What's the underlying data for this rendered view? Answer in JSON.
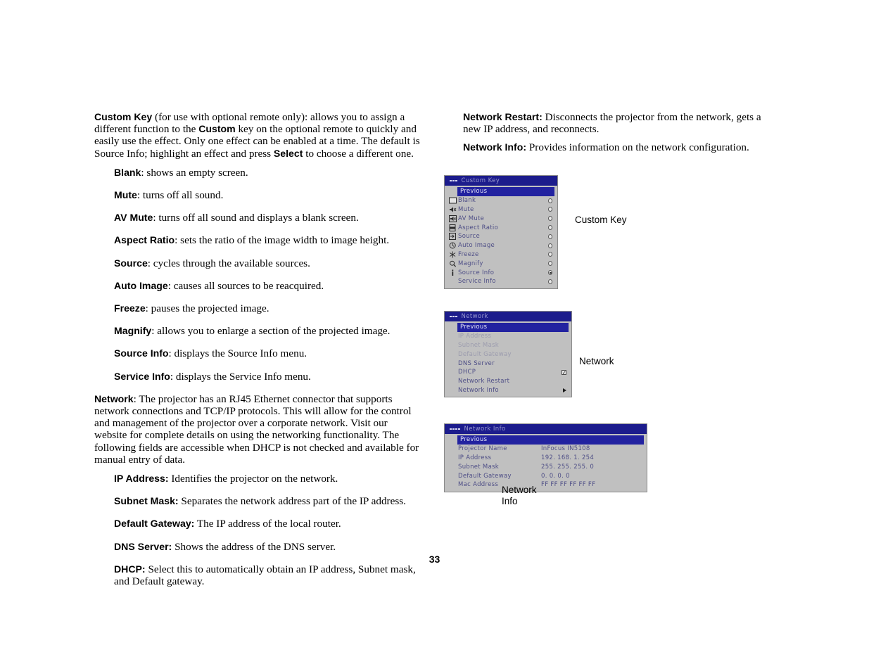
{
  "page": {
    "number": "33"
  },
  "left_column": {
    "intro": {
      "lead": "Custom Key",
      "text": " (for use with optional remote only): allows you to assign a different function to the ",
      "lead2": "Custom",
      "text2": " key on the optional remote to quickly and easily use the effect. Only one effect can be enabled at a time. The default is Source Info; highlight an effect and press ",
      "lead3": "Select",
      "text3": " to choose a different one."
    },
    "effects": [
      {
        "term": "Blank",
        "desc": ": shows an empty screen."
      },
      {
        "term": "Mute",
        "desc": ": turns off all sound."
      },
      {
        "term": "AV Mute",
        "desc": ": turns off all sound and displays a blank screen."
      },
      {
        "term": "Aspect Ratio",
        "desc": ": sets the ratio of the image width to image height."
      },
      {
        "term": "Source",
        "desc": ": cycles through the available sources."
      },
      {
        "term": "Auto Image",
        "desc": ": causes all sources to be reacquired."
      },
      {
        "term": "Freeze",
        "desc": ": pauses the projected image."
      },
      {
        "term": "Magnify",
        "desc": ": allows you to enlarge a section of the projected image."
      },
      {
        "term": "Source Info",
        "desc": ": displays the Source Info menu."
      },
      {
        "term": "Service Info",
        "desc": ": displays the Service Info menu."
      }
    ],
    "network_paragraph": {
      "term": "Network",
      "desc": ": The projector has an RJ45 Ethernet connector that supports network connections and TCP/IP protocols. This will allow for the control and management of the projector over a corporate network. Visit our website for complete details on using the networking functionality. The following fields are accessible when DHCP is not checked and available for manual entry of data."
    },
    "network_fields": [
      {
        "term": "IP Address:",
        "desc": " Identifies the projector on the network."
      },
      {
        "term": "Subnet Mask:",
        "desc": " Separates the network address part of the IP address."
      },
      {
        "term": "Default Gateway:",
        "desc": " The IP address of the local router."
      },
      {
        "term": "DNS Server:",
        "desc": " Shows the address of the DNS server."
      },
      {
        "term": "DHCP:",
        "desc": " Select this to automatically obtain an IP address, Subnet mask, and Default gateway."
      }
    ]
  },
  "right_column": {
    "items": [
      {
        "term": "Network Restart:",
        "desc": " Disconnects the projector from the network, gets a new IP address, and reconnects."
      },
      {
        "term": "Network Info:",
        "desc": " Provides information on the network configuration."
      }
    ]
  },
  "figures": {
    "custom_key": {
      "caption": "Custom Key",
      "title": "Custom Key",
      "title_dots": 3,
      "rows": [
        {
          "label": "Previous",
          "icon": "none",
          "selected": true,
          "control": "none"
        },
        {
          "label": "Blank",
          "icon": "blank-icon",
          "selected": false,
          "control": "radio",
          "checked": false
        },
        {
          "label": "Mute",
          "icon": "mute-icon",
          "selected": false,
          "control": "radio",
          "checked": false
        },
        {
          "label": "AV Mute",
          "icon": "av-mute-icon",
          "selected": false,
          "control": "radio",
          "checked": false
        },
        {
          "label": "Aspect Ratio",
          "icon": "aspect-ratio-icon",
          "selected": false,
          "control": "radio",
          "checked": false
        },
        {
          "label": "Source",
          "icon": "source-icon",
          "selected": false,
          "control": "radio",
          "checked": false
        },
        {
          "label": "Auto Image",
          "icon": "auto-image-icon",
          "selected": false,
          "control": "radio",
          "checked": false
        },
        {
          "label": "Freeze",
          "icon": "freeze-icon",
          "selected": false,
          "control": "radio",
          "checked": false
        },
        {
          "label": "Magnify",
          "icon": "magnify-icon",
          "selected": false,
          "control": "radio",
          "checked": false
        },
        {
          "label": "Source Info",
          "icon": "info-icon",
          "selected": false,
          "control": "radio",
          "checked": true
        },
        {
          "label": "Service Info",
          "icon": "none",
          "selected": false,
          "control": "radio",
          "checked": false
        }
      ]
    },
    "network": {
      "caption": "Network",
      "title": "Network",
      "title_dots": 3,
      "rows": [
        {
          "label": "Previous",
          "selected": true,
          "dim": false,
          "control": "none"
        },
        {
          "label": "IP Address",
          "selected": false,
          "dim": true,
          "control": "none"
        },
        {
          "label": "Subnet Mask",
          "selected": false,
          "dim": true,
          "control": "none"
        },
        {
          "label": "Default Gateway",
          "selected": false,
          "dim": true,
          "control": "none"
        },
        {
          "label": "DNS Server",
          "selected": false,
          "dim": false,
          "control": "none"
        },
        {
          "label": "DHCP",
          "selected": false,
          "dim": false,
          "control": "checkbox",
          "checked": true
        },
        {
          "label": "Network Restart",
          "selected": false,
          "dim": false,
          "control": "none"
        },
        {
          "label": "Network Info",
          "selected": false,
          "dim": false,
          "control": "arrow"
        }
      ]
    },
    "network_info": {
      "caption": "Network\nInfo",
      "title": "Network Info",
      "title_dots": 4,
      "rows": [
        {
          "label": "Previous",
          "value": "",
          "selected": true
        },
        {
          "label": "Projector Name",
          "value": "InFocus IN5108",
          "selected": false
        },
        {
          "label": "IP Address",
          "value": "192. 168. 1. 254",
          "selected": false
        },
        {
          "label": "Subnet Mask",
          "value": "255. 255. 255. 0",
          "selected": false
        },
        {
          "label": "Default Gateway",
          "value": "0. 0. 0. 0",
          "selected": false
        },
        {
          "label": "Mac Address",
          "value": "FF FF FF FF FF FF",
          "selected": false
        }
      ]
    }
  },
  "colors": {
    "osd_title_bg": "#1c1c8c",
    "osd_title_fg": "#9a9ad0",
    "osd_body_bg": "#c0c0c0",
    "osd_text": "#4e4e86",
    "osd_selected_bg": "#2222a0",
    "osd_selected_fg": "#e6e6f8",
    "osd_dim_text": "#9c9cae"
  }
}
